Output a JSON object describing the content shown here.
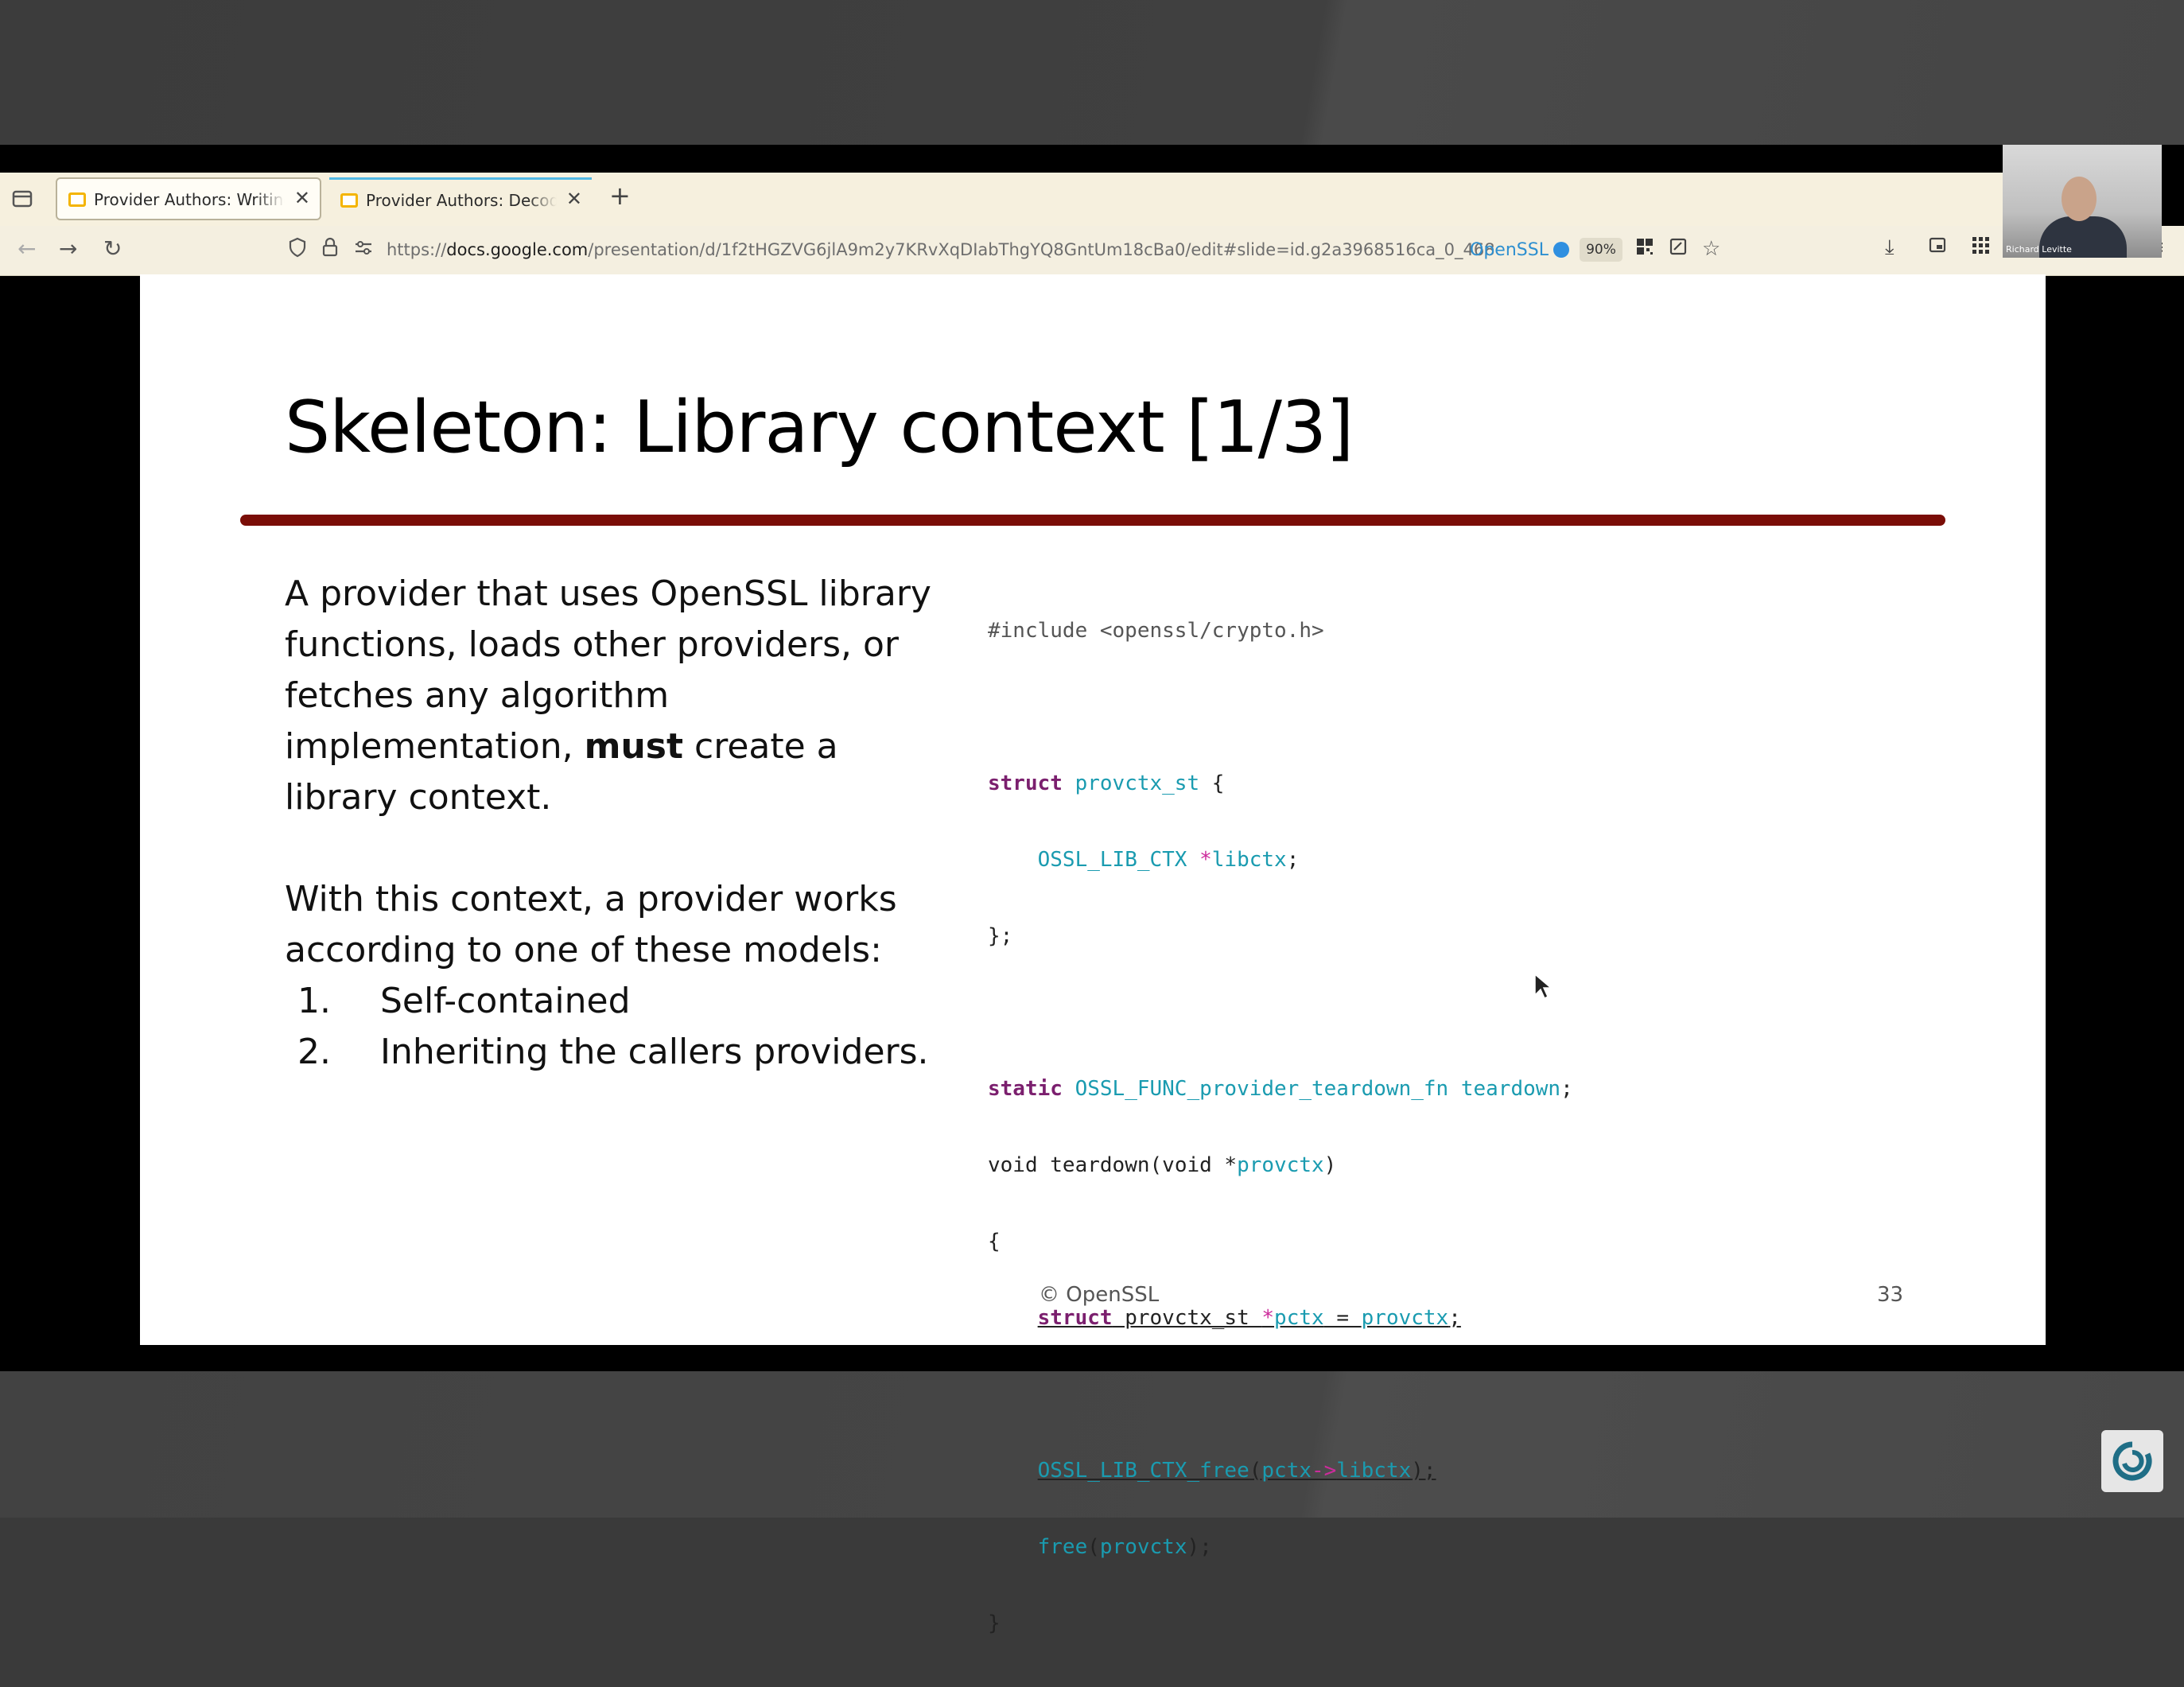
{
  "browser": {
    "tabs": [
      {
        "title": "Provider Authors: Writing a",
        "close": "✕"
      },
      {
        "title": "Provider Authors: Decoders",
        "close": "✕"
      }
    ],
    "new_tab": "+",
    "url_prefix": "https://",
    "url_host": "docs.google.com",
    "url_path": "/presentation/d/1f2tHGZVG6jlA9m2y7KRvXqDIabThgYQ8GntUm18cBa0/edit#slide=id.g2a3968516ca_0_468",
    "extension_label": "OpenSSL",
    "zoom": "90%"
  },
  "webcam": {
    "name": "Richard Levitte"
  },
  "slide": {
    "title": "Skeleton: Library context [1/3]",
    "para1_before": "A provider that uses OpenSSL library functions, loads other providers, or fetches any algorithm implementation, ",
    "para1_bold": "must",
    "para1_after": " create a library context.",
    "para2": "With this context, a provider works according to one of these models:",
    "list": [
      {
        "num": "1.",
        "label": "Self-contained"
      },
      {
        "num": "2.",
        "label": "Inheriting the callers providers."
      }
    ],
    "footer": "© OpenSSL",
    "page_number": "33"
  },
  "code": {
    "l1": "#include <openssl/crypto.h>",
    "l3_kw": "struct",
    "l3_id": "provctx_st",
    "l3_rest": " {",
    "l4_ty": "OSSL_LIB_CTX",
    "l4_star": "*",
    "l4_id": "libctx",
    "l4_rest": ";",
    "l5": "};",
    "l7_kw": "static",
    "l7_ty": "OSSL_FUNC_provider_teardown_fn",
    "l7_id": "teardown",
    "l7_rest": ";",
    "l8_a": "void",
    "l8_b": "teardown",
    "l8_c": "(void *",
    "l8_d": "provctx",
    "l8_e": ")",
    "l9": "{",
    "l10_kw": "struct",
    "l10_a": " provctx_st ",
    "l10_star": "*",
    "l10_b": "pctx",
    "l10_c": " = ",
    "l10_d": "provctx",
    "l10_e": ";",
    "l12_a": "OSSL_LIB_CTX_free",
    "l12_b": "(",
    "l12_c": "pctx",
    "l12_d": "->",
    "l12_e": "libctx",
    "l12_f": ");",
    "l13_a": "free",
    "l13_b": "(",
    "l13_c": "provctx",
    "l13_d": ");",
    "l14": "}"
  }
}
